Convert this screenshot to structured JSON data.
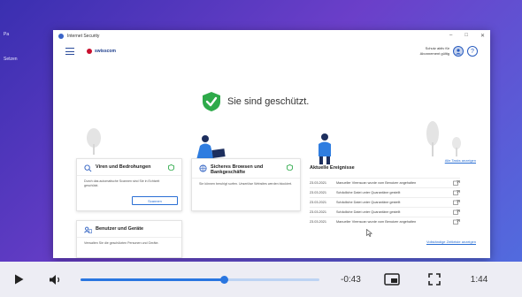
{
  "desktop": {
    "items": [
      "Pa",
      "Setzen"
    ]
  },
  "window": {
    "title": "Internet Security",
    "controls": [
      "–",
      "□",
      "✕"
    ]
  },
  "header": {
    "brand": "swisscom",
    "subscription_line1": "Schutz aktiv für",
    "subscription_line2": "Abonnement gültig",
    "help_label": "?"
  },
  "hero": {
    "status": "Sie sind geschützt.",
    "all_tasks": "Alle Tasks anzeigen"
  },
  "cards": {
    "viruses": {
      "title": "Viren und Bedrohungen",
      "body": "Durch das automatische Scannen sind Sie in Echtzeit geschützt.",
      "button": "Scannen"
    },
    "browsing": {
      "title": "Sicheres Browsen und Bankgeschäfte",
      "body": "Sie können beruhigt surfen. Unseriöse Websites werden blockiert."
    },
    "users": {
      "title": "Benutzer und Geräte",
      "body": "Verwalten Sie die geschützten Personen und Geräte."
    }
  },
  "events": {
    "title": "Aktuelle Ereignisse",
    "rows": [
      {
        "date": "23.03.2021",
        "text": "Manueller Virenscan wurde vom Benutzer angehalten"
      },
      {
        "date": "23.03.2021",
        "text": "Schädliche Datei unter Quarantäne gestellt"
      },
      {
        "date": "23.03.2021",
        "text": "Schädliche Datei unter Quarantäne gestellt"
      },
      {
        "date": "23.03.2021",
        "text": "Schädliche Datei unter Quarantäne gestellt"
      },
      {
        "date": "23.03.2021",
        "text": "Manueller Virenscan wurde vom Benutzer angehalten"
      }
    ],
    "more": "Vollständige Zeitleiste anzeigen"
  },
  "player": {
    "progress_fraction": 0.6,
    "remaining": "-0:43",
    "duration": "1:44"
  },
  "colors": {
    "accent": "#2a76e0",
    "shield_green": "#2eaa4a",
    "brand_red": "#c8102e"
  }
}
